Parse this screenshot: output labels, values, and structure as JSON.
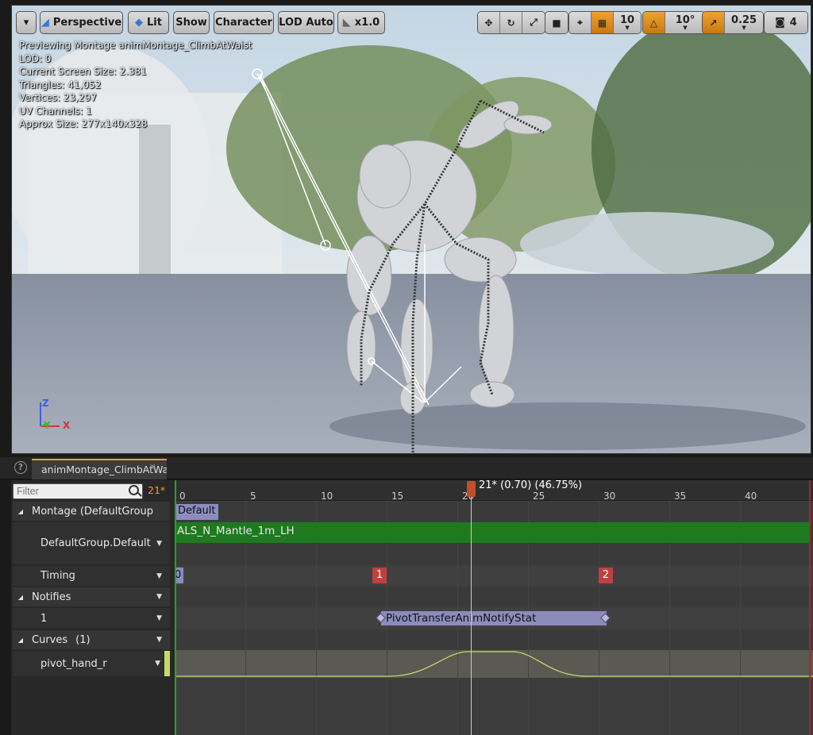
{
  "toolbar": {
    "menu_label": "",
    "view_mode": "Perspective",
    "lighting": "Lit",
    "show": "Show",
    "character": "Character",
    "lod": "LOD Auto",
    "speed": "x1.0",
    "grid_snap": "10",
    "rotate_snap": "10°",
    "scale_snap": "0.25",
    "camera_speed": "4"
  },
  "stats": {
    "line1": "Previewing Montage animMontage_ClimbAtWaist",
    "line2": "LOD: 0",
    "line3": "Current Screen Size: 2.381",
    "line4": "Triangles: 41,052",
    "line5": "Vertices: 23,297",
    "line6": "UV Channels: 1",
    "line7": "Approx Size: 277x140x328"
  },
  "axes": {
    "z": "Z",
    "y": "Y",
    "x": "X"
  },
  "tab": {
    "title": "animMontage_ClimbAtWaist",
    "help": "?",
    "close": "✕"
  },
  "left": {
    "filter_placeholder": "Filter",
    "current_frame": "21*",
    "montage": "Montage (DefaultGroup",
    "group": "DefaultGroup.Default",
    "timing": "Timing",
    "notifies": "Notifies",
    "notify_track": "1",
    "curves": "Curves",
    "curves_count": "(1)",
    "curve_name": "pivot_hand_r"
  },
  "timeline": {
    "ticks": [
      "0",
      "5",
      "10",
      "15",
      "20",
      "25",
      "30",
      "35",
      "40"
    ],
    "scrub_label": "21* (0.70) (46.75%)",
    "section": "Default",
    "segment": "ALS_N_Mantle_1m_LH",
    "timing_start": "0",
    "timing_1": "1",
    "timing_2": "2",
    "notify": "PivotTransferAnimNotifyStat"
  },
  "colors": {
    "accent": "#e8a020",
    "segment": "#1f7a1f",
    "notify": "#8c8cbc",
    "badge": "#c04040"
  }
}
